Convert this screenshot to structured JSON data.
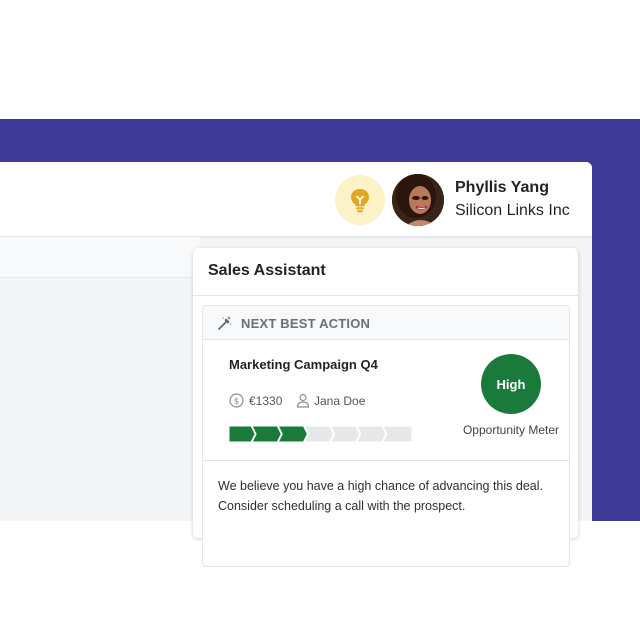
{
  "user": {
    "name": "Phyllis Yang",
    "company": "Silicon Links Inc",
    "avatar_icon": "user-avatar-photo"
  },
  "header": {
    "bulb_icon": "lightbulb-icon",
    "bulb_color": "#e0a820",
    "bulb_bg": "#fdf1c8"
  },
  "panel": {
    "title": "Sales Assistant"
  },
  "next_best_action": {
    "label": "NEXT BEST ACTION",
    "deal_title": "Marketing Campaign Q4",
    "amount": "€1330",
    "owner": "Jana Doe",
    "progress_completed": 3,
    "progress_total": 7,
    "opportunity_level": "High",
    "opportunity_label": "Opportunity Meter",
    "message": "We believe you have a high chance of advancing this deal. Consider scheduling a call with the prospect."
  },
  "colors": {
    "brand_band": "#3d3b97",
    "progress_done": "#1a7a3c",
    "progress_pending": "#e7e8ea",
    "badge": "#1a7a3c"
  }
}
